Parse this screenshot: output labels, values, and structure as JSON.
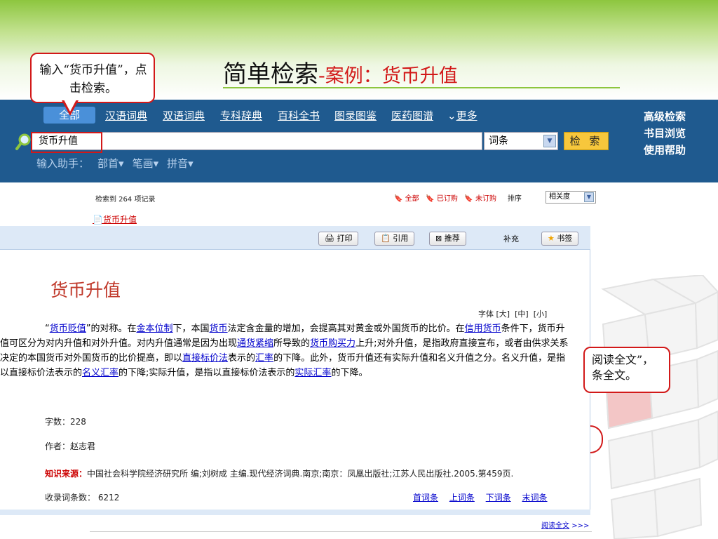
{
  "slide": {
    "title": "简单检索",
    "subtitle": "-案例：货币升值",
    "callout_1": "输入“货币升值”，点击检索。",
    "callout_2_line1": "阅读全文”，",
    "callout_2_line2": "条全文。"
  },
  "search": {
    "active_tab": "全部",
    "tabs": [
      "汉语词典",
      "双语词典",
      "专科辞典",
      "百科全书",
      "图录图鉴",
      "医药图谱"
    ],
    "more": "更多",
    "query": "货币升值",
    "field_select": "词条",
    "search_button": "检 索",
    "helper_label": "输入助手：",
    "helper_items": [
      "部首",
      "笔画",
      "拼音"
    ],
    "right_links": [
      "高级检索",
      "书目浏览",
      "使用帮助"
    ]
  },
  "results": {
    "count_text": "检索到 264 项记录",
    "filters": [
      "全部",
      "已订购",
      "未订购"
    ],
    "sort_label": "排序",
    "sort_value": "相关度",
    "result_link": "货币升值"
  },
  "toolbar": {
    "print": "打印",
    "cite": "引用",
    "recommend": "推荐",
    "supplement": "补充",
    "bookmark": "书签"
  },
  "entry": {
    "title": "货币升值",
    "font_size_label": "字体",
    "font_sizes": [
      "[大]",
      "[中]",
      "[小]"
    ],
    "body": {
      "t1": "“",
      "l1": "货币贬值",
      "t2": "”的对称。在",
      "l2": "金本位制",
      "t3": "下，本国",
      "l3": "货币",
      "t4": "法定含金量的增加，会提高其对黄金或外国货币的比价。在",
      "l4": "信用货币",
      "t5": "条件下，货币升值可区分为对内升值和对外升值。对内升值通常是因为出现",
      "l5": "通货紧缩",
      "t6": "所导致的",
      "l6": "货币购买力",
      "t7": "上升;对外升值，是指政府直接宣布，或者由供求关系决定的本国货币对外国货币的比价提高，即以",
      "l7": "直接标价法",
      "t8": "表示的",
      "l8": "汇率",
      "t9": "的下降。此外，货币升值还有实际升值和名义升值之分。名义升值，是指以直接标价法表示的",
      "l9": "名义汇率",
      "t10": "的下降;实际升值，是指以直接标价法表示的",
      "l10": "实际汇率",
      "t11": "的下降。"
    },
    "word_count": "字数：228",
    "author": "作者：赵志君",
    "source_label": "知识来源：",
    "source": "中国社会科学院经济研究所 编;刘树成 主编.现代经济词典.南京;南京：凤凰出版社;江苏人民出版社.2005.第459页.",
    "entries_count": "收录词条数： 6212",
    "pager": [
      "首词条",
      "上词条",
      "下词条",
      "末词条"
    ],
    "read_full": "阅读全文",
    "read_full_arrow": ">>>"
  },
  "colors": {
    "accent_red": "#d21919",
    "bar_blue": "#1f5a8f",
    "title_green": "#8dc63f"
  }
}
